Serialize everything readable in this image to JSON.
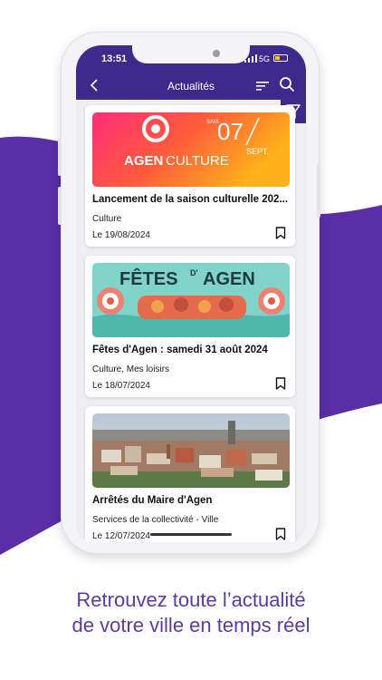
{
  "colors": {
    "brand_purple": "#3d2a8c",
    "wave_purple": "#5b2ea6",
    "tagline": "#5c3aa8"
  },
  "status_bar": {
    "time": "13:51",
    "network": "5G"
  },
  "header": {
    "title": "Actualités",
    "icons": [
      "back-icon",
      "sort-icon",
      "search-icon",
      "filter-icon"
    ]
  },
  "news": [
    {
      "title": "Lancement de la saison culturelle 202...",
      "category": "Culture",
      "date": "Le 19/08/2024",
      "image": {
        "brand_a": "AGEN",
        "brand_b": "CULTURE",
        "sam": "SAM.",
        "day": "07",
        "month": "SEPT."
      }
    },
    {
      "title": "Fêtes d'Agen : samedi 31 août 2024",
      "category": "Culture, Mes loisirs",
      "date": "Le 18/07/2024",
      "image": {
        "word1": "FÊTES",
        "word2": "D'",
        "word3": "AGEN"
      }
    },
    {
      "title": "Arrêtés du Maire d'Agen",
      "category": "Services de la collectivité - Ville",
      "date": "Le 12/07/2024",
      "image": {}
    }
  ],
  "tagline": {
    "line1": "Retrouvez toute l’actualité",
    "line2": "de votre ville en temps réel"
  }
}
